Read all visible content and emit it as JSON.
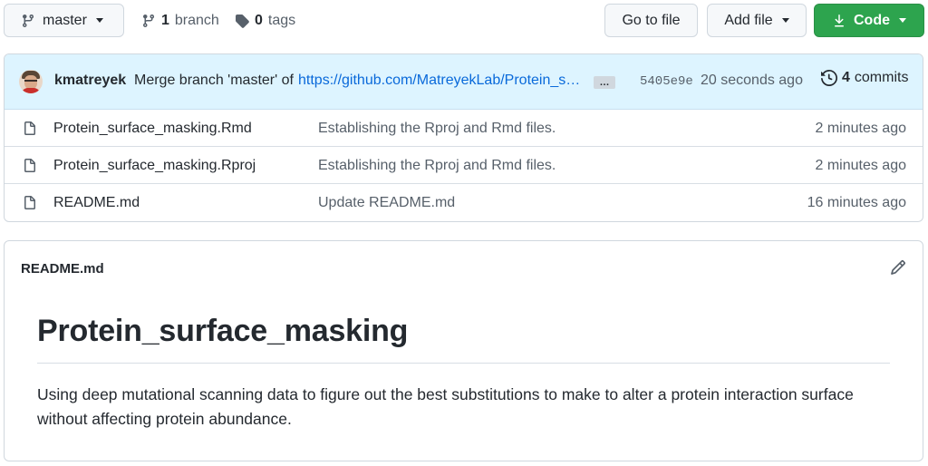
{
  "toolbar": {
    "branch_label": "master",
    "branch_count": "1",
    "branch_word": "branch",
    "tag_count": "0",
    "tag_word": "tags",
    "go_to_file": "Go to file",
    "add_file": "Add file",
    "code": "Code"
  },
  "commit": {
    "author": "kmatreyek",
    "message": "Merge branch 'master' of",
    "link": "https://github.com/MatreyekLab/Protein_surface_masking",
    "ellipsis": "…",
    "sha": "5405e9e",
    "time": "20 seconds ago",
    "count": "4",
    "count_word": "commits"
  },
  "files": [
    {
      "name": "Protein_surface_masking.Rmd",
      "commit": "Establishing the Rproj and Rmd files.",
      "age": "2 minutes ago",
      "icon": "file-icon"
    },
    {
      "name": "Protein_surface_masking.Rproj",
      "commit": "Establishing the Rproj and Rmd files.",
      "age": "2 minutes ago",
      "icon": "file-icon"
    },
    {
      "name": "README.md",
      "commit": "Update README.md",
      "age": "16 minutes ago",
      "icon": "file-icon"
    }
  ],
  "readme": {
    "title": "README.md",
    "heading": "Protein_surface_masking",
    "body": "Using deep mutational scanning data to figure out the best substitutions to make to alter a protein interaction surface without affecting protein abundance."
  },
  "colors": {
    "primary_button": "#2da44e",
    "commit_bar_bg": "#ddf4ff",
    "link": "#0969da",
    "muted_text": "#57606a"
  }
}
